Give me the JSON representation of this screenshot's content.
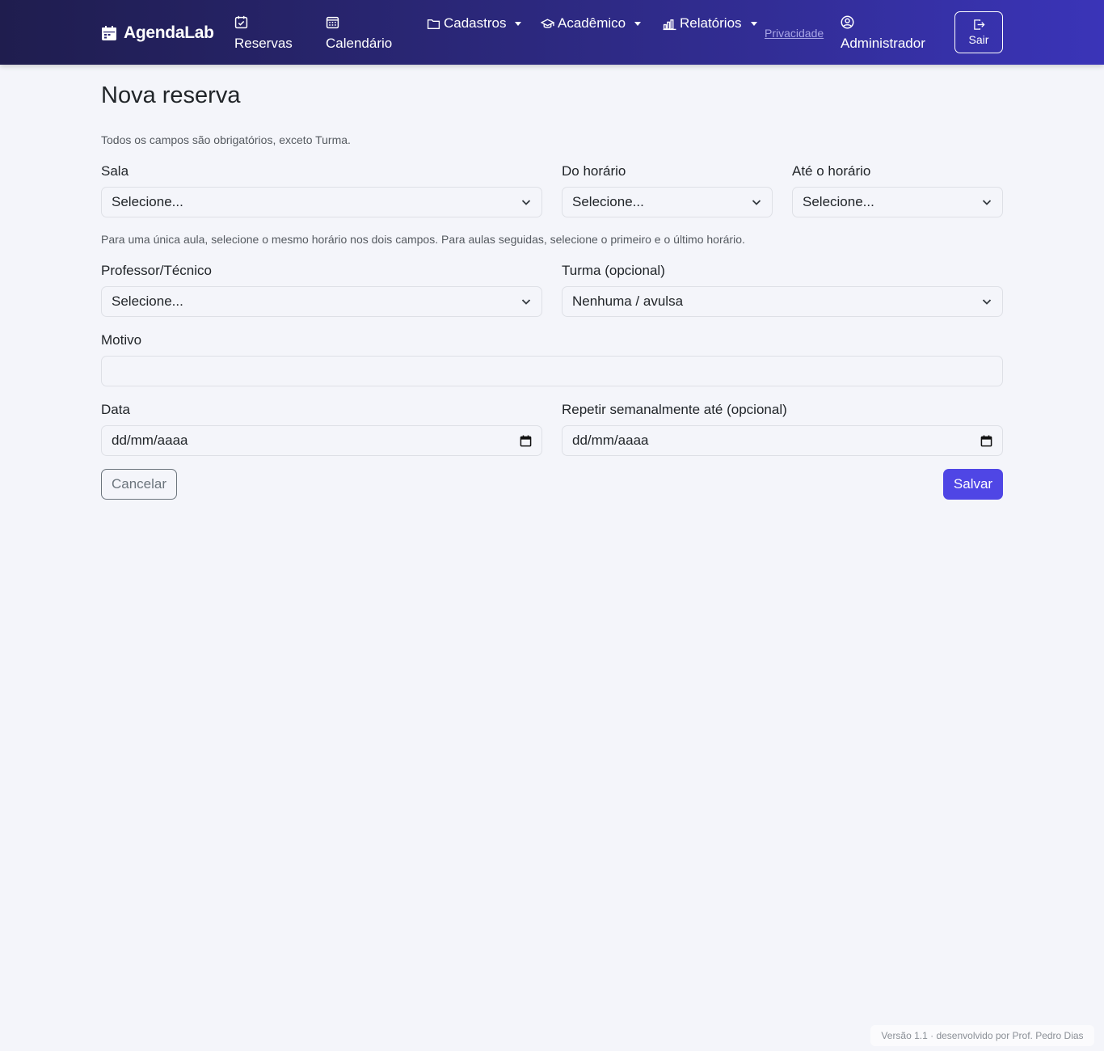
{
  "navbar": {
    "brand": "AgendaLab",
    "reservas": "Reservas",
    "calendario": "Calendário",
    "cadastros": "Cadastros",
    "academico": "Acadêmico",
    "relatorios": "Relatórios",
    "privacidade": "Privacidade",
    "usuario": "Administrador",
    "sair": "Sair"
  },
  "page": {
    "title": "Nova reserva",
    "required_note": "Todos os campos são obrigatórios, exceto Turma.",
    "horario_hint": "Para uma única aula, selecione o mesmo horário nos dois campos. Para aulas seguidas, selecione o primeiro e o último horário."
  },
  "form": {
    "sala": {
      "label": "Sala",
      "value": "Selecione..."
    },
    "do_horario": {
      "label": "Do horário",
      "value": "Selecione..."
    },
    "ate_horario": {
      "label": "Até o horário",
      "value": "Selecione..."
    },
    "professor": {
      "label": "Professor/Técnico",
      "value": "Selecione..."
    },
    "turma": {
      "label": "Turma (opcional)",
      "value": "Nenhuma / avulsa"
    },
    "motivo": {
      "label": "Motivo",
      "value": ""
    },
    "data": {
      "label": "Data",
      "placeholder": "dd/mm/aaaa"
    },
    "repetir": {
      "label": "Repetir semanalmente até (opcional)",
      "placeholder": "dd/mm/aaaa"
    },
    "cancel_label": "Cancelar",
    "save_label": "Salvar"
  },
  "footer": {
    "text": "Versão 1.1 · desenvolvido por Prof. Pedro Dias"
  },
  "colors": {
    "navbar_start": "#1f1d4e",
    "navbar_end": "#3a34b8",
    "primary": "#4f46e5",
    "background": "#f4f5fa"
  },
  "icons": {
    "brand": "calendar-icon",
    "reservas": "calendar-check-icon",
    "calendario": "calendar-grid-icon",
    "cadastros": "folder-icon",
    "academico": "graduation-cap-icon",
    "relatorios": "bar-chart-icon",
    "usuario": "user-circle-icon",
    "sair": "logout-icon",
    "select": "chevron-down-icon",
    "date": "calendar-icon"
  }
}
